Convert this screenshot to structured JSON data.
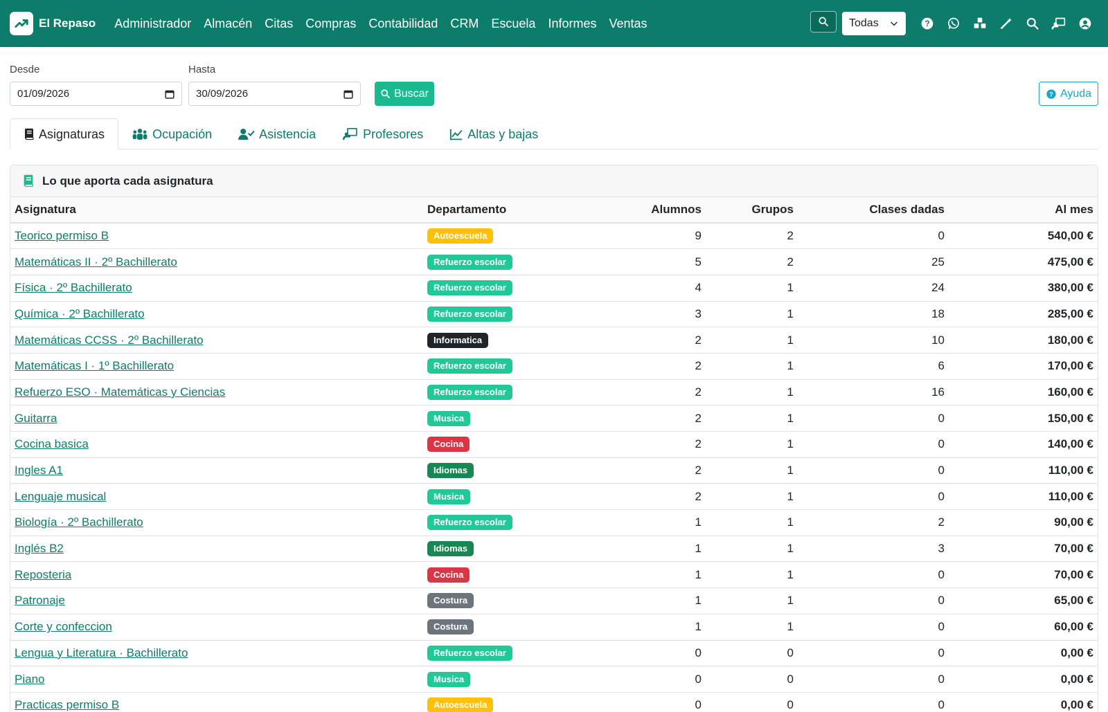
{
  "app": {
    "name": "El Repaso"
  },
  "menu": [
    "Administrador",
    "Almacén",
    "Citas",
    "Compras",
    "Contabilidad",
    "CRM",
    "Escuela",
    "Informes",
    "Ventas"
  ],
  "header_tools": {
    "scope_select": "Todas"
  },
  "filters": {
    "from_label": "Desde",
    "from_value": "01/09/2026",
    "to_label": "Hasta",
    "to_value": "30/09/2026",
    "search_label": "Buscar",
    "help_label": "Ayuda"
  },
  "tabs": [
    {
      "label": "Asignaturas",
      "icon": "book-icon",
      "active": true
    },
    {
      "label": "Ocupación",
      "icon": "users-icon",
      "active": false
    },
    {
      "label": "Asistencia",
      "icon": "user-check-icon",
      "active": false
    },
    {
      "label": "Profesores",
      "icon": "chalkboard-teacher-icon",
      "active": false
    },
    {
      "label": "Altas y bajas",
      "icon": "chart-line-icon",
      "active": false
    }
  ],
  "card": {
    "title": "Lo que aporta cada asignatura"
  },
  "table": {
    "columns": [
      "Asignatura",
      "Departamento",
      "Alumnos",
      "Grupos",
      "Clases dadas",
      "Al mes"
    ],
    "rows": [
      [
        "Teorico permiso B",
        "Autoescuela",
        "9",
        "2",
        "0",
        "540,00 €"
      ],
      [
        "Matemáticas II · 2º Bachillerato",
        "Refuerzo escolar",
        "5",
        "2",
        "25",
        "475,00 €"
      ],
      [
        "Física · 2º Bachillerato",
        "Refuerzo escolar",
        "4",
        "1",
        "24",
        "380,00 €"
      ],
      [
        "Química · 2º Bachillerato",
        "Refuerzo escolar",
        "3",
        "1",
        "18",
        "285,00 €"
      ],
      [
        "Matemáticas CCSS · 2º Bachillerato",
        "Informatica",
        "2",
        "1",
        "10",
        "180,00 €"
      ],
      [
        "Matemáticas I · 1º Bachillerato",
        "Refuerzo escolar",
        "2",
        "1",
        "6",
        "170,00 €"
      ],
      [
        "Refuerzo ESO · Matemáticas y Ciencias",
        "Refuerzo escolar",
        "2",
        "1",
        "16",
        "160,00 €"
      ],
      [
        "Guitarra",
        "Musica",
        "2",
        "1",
        "0",
        "150,00 €"
      ],
      [
        "Cocina basica",
        "Cocina",
        "2",
        "1",
        "0",
        "140,00 €"
      ],
      [
        "Ingles A1",
        "Idiomas",
        "2",
        "1",
        "0",
        "110,00 €"
      ],
      [
        "Lenguaje musical",
        "Musica",
        "2",
        "1",
        "0",
        "110,00 €"
      ],
      [
        "Biología · 2º Bachillerato",
        "Refuerzo escolar",
        "1",
        "1",
        "2",
        "90,00 €"
      ],
      [
        "Inglés B2",
        "Idiomas",
        "1",
        "1",
        "3",
        "70,00 €"
      ],
      [
        "Reposteria",
        "Cocina",
        "1",
        "1",
        "0",
        "70,00 €"
      ],
      [
        "Patronaje",
        "Costura",
        "1",
        "1",
        "0",
        "65,00 €"
      ],
      [
        "Corte y confeccion",
        "Costura",
        "1",
        "1",
        "0",
        "60,00 €"
      ],
      [
        "Lengua y Literatura · Bachillerato",
        "Refuerzo escolar",
        "0",
        "0",
        "0",
        "0,00 €"
      ],
      [
        "Piano",
        "Musica",
        "0",
        "0",
        "0",
        "0,00 €"
      ],
      [
        "Practicas permiso B",
        "Autoescuela",
        "0",
        "0",
        "0",
        "0,00 €"
      ]
    ]
  },
  "department_colors": {
    "Autoescuela": "#ffc107",
    "Refuerzo escolar": "#20c997",
    "Informatica": "#212529",
    "Musica": "#20c997",
    "Cocina": "#dc3545",
    "Idiomas": "#198754",
    "Costura": "#6c757d"
  },
  "colors": {
    "brand": "#0e7c6a",
    "accent": "#1bb98f",
    "info": "#17a7c4"
  }
}
